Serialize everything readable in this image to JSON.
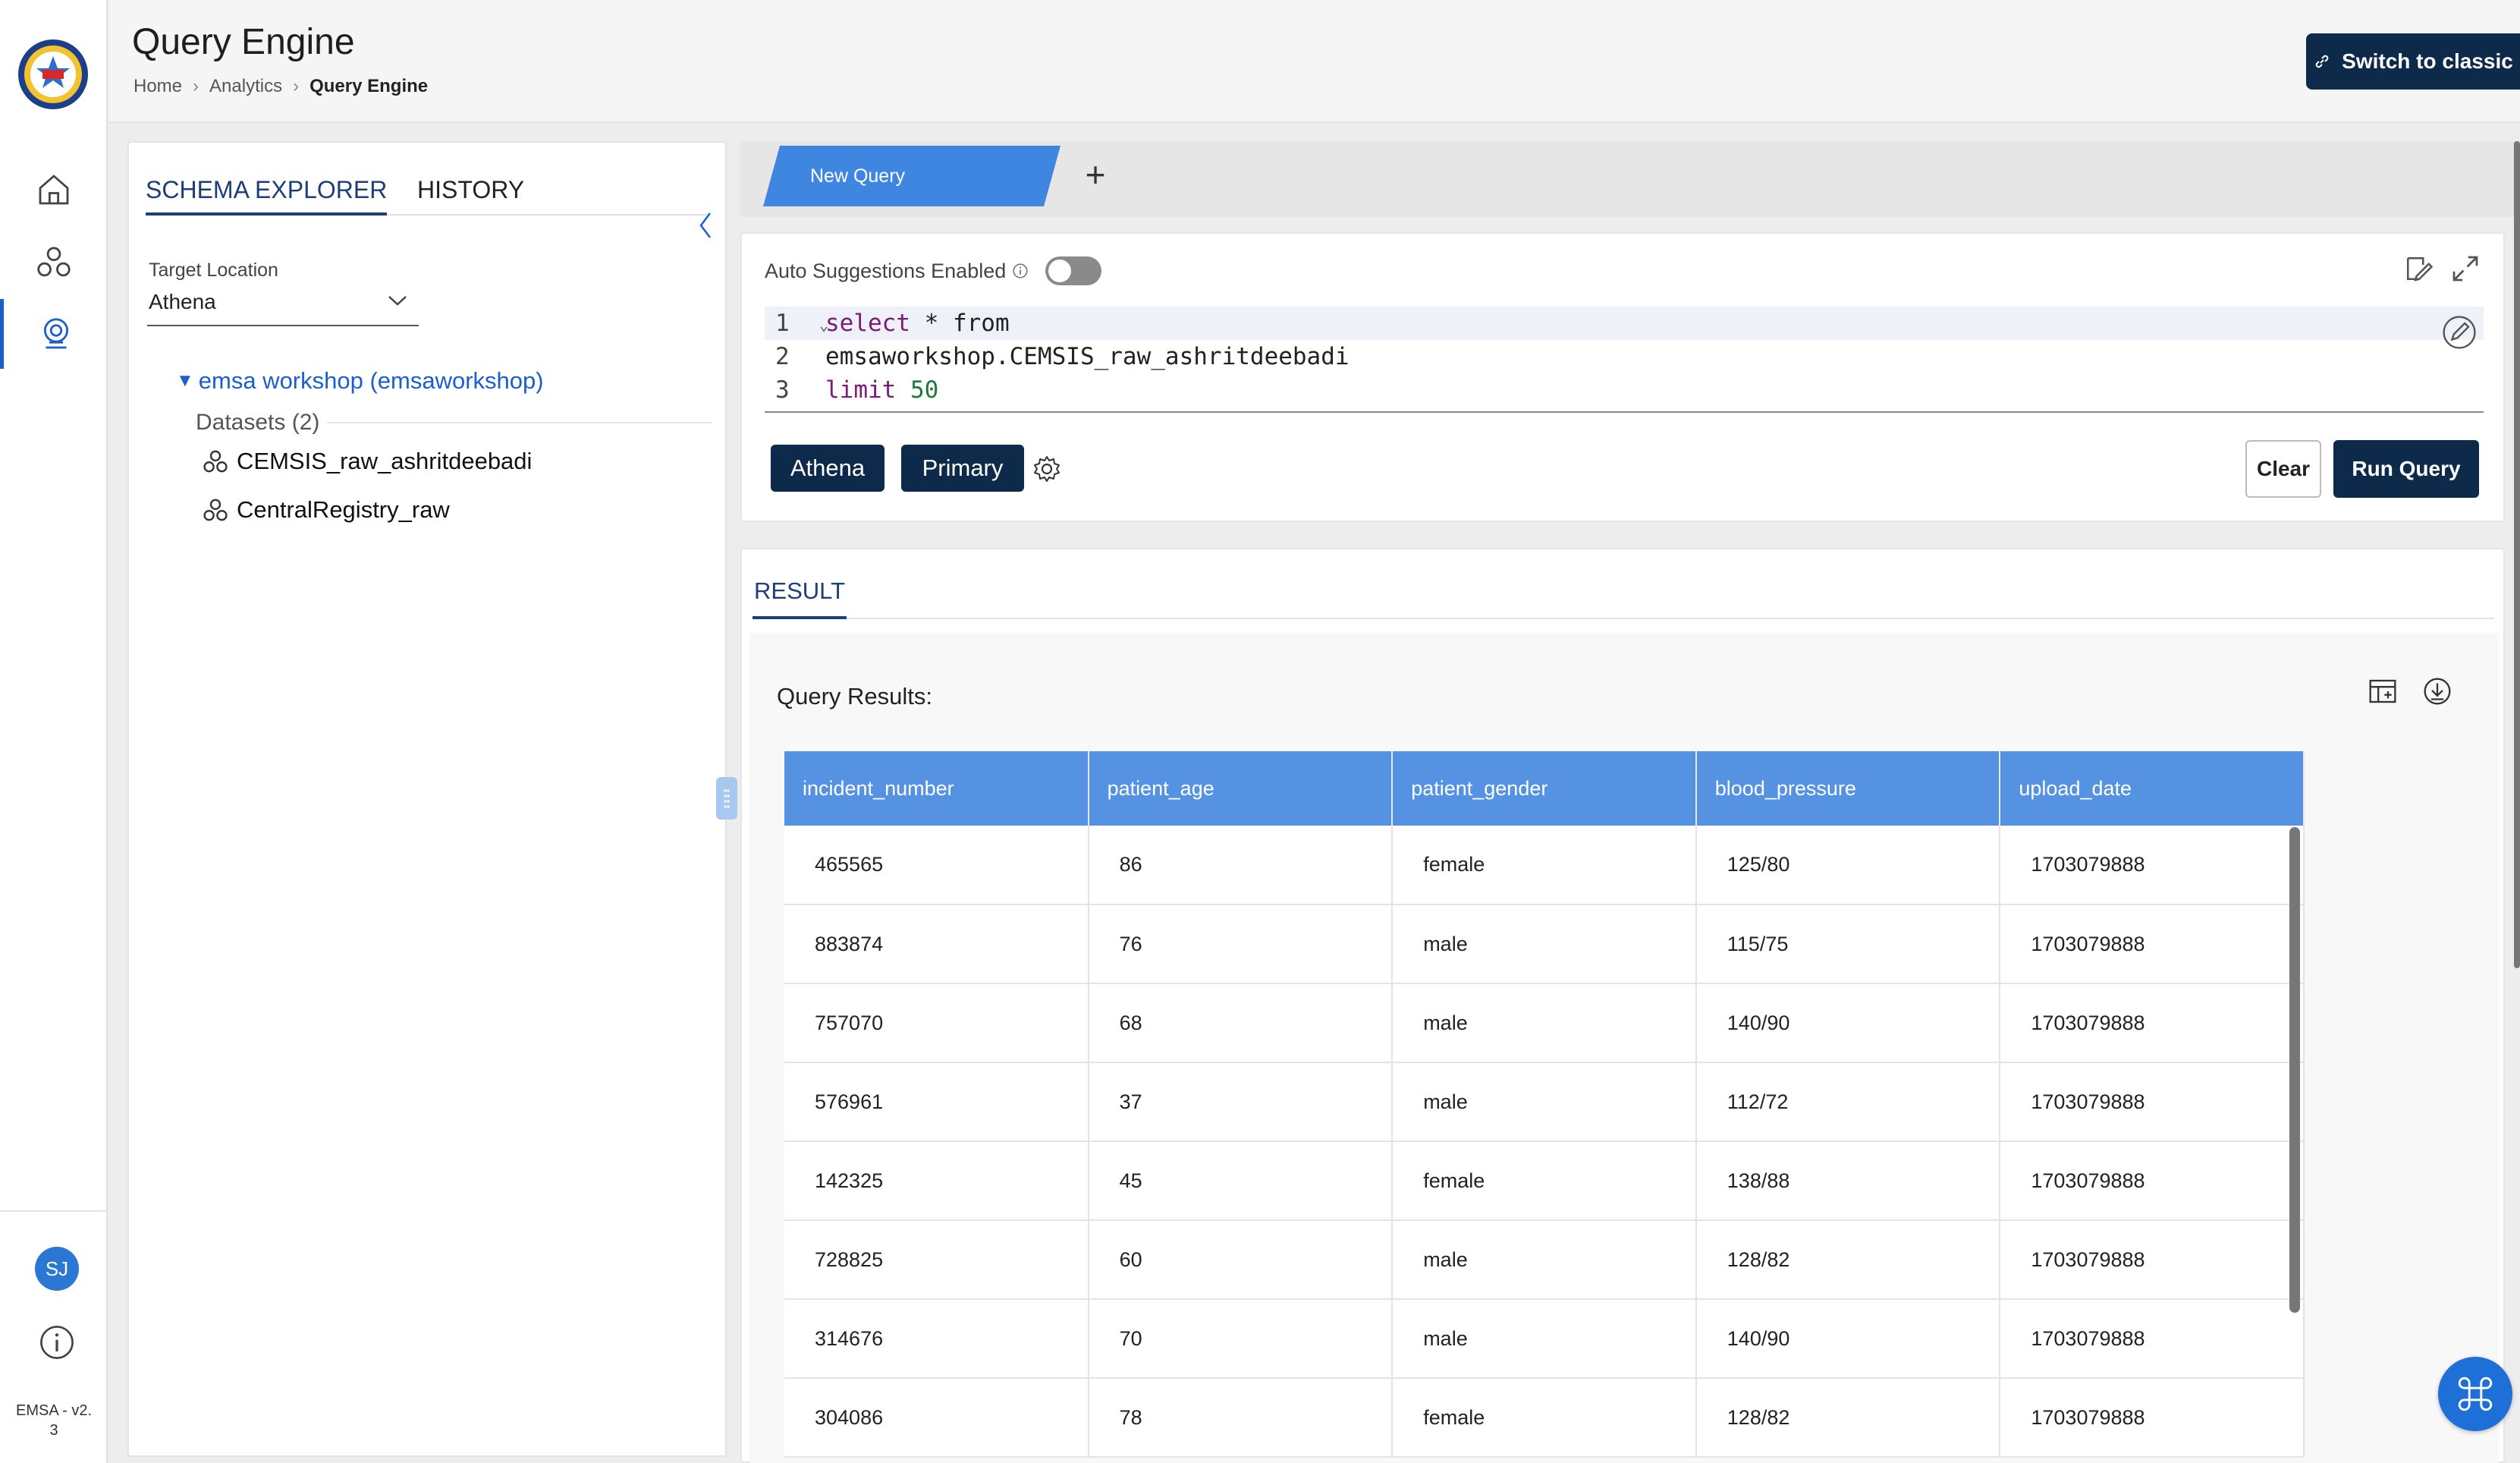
{
  "app": {
    "version": "EMSA - v2.\n3"
  },
  "nav": {
    "logo": "emsa-logo",
    "items": [
      {
        "name": "home-icon"
      },
      {
        "name": "datasets-icon"
      },
      {
        "name": "query-icon"
      }
    ],
    "avatar_initials": "SJ",
    "info_icon": "info-icon"
  },
  "header": {
    "title": "Query Engine",
    "breadcrumb": [
      "Home",
      "Analytics",
      "Query Engine"
    ],
    "switch_label": "Switch to classic"
  },
  "schema_explorer": {
    "tabs": [
      "SCHEMA EXPLORER",
      "HISTORY"
    ],
    "active_tab": "SCHEMA EXPLORER",
    "target_label": "Target Location",
    "target_value": "Athena",
    "database": "emsa workshop (emsaworkshop)",
    "datasets_label": "Datasets (2)",
    "datasets": [
      "CEMSIS_raw_ashritdeebadi",
      "CentralRegistry_raw"
    ]
  },
  "editor": {
    "tab_label": "New Query",
    "auto_suggestions_label": "Auto Suggestions Enabled",
    "auto_suggestions_on": false,
    "lines": [
      {
        "num": "1",
        "kw": "select",
        "rest": " * from"
      },
      {
        "num": "2",
        "kw": "",
        "rest": "emsaworkshop.CEMSIS_raw_ashritdeebadi"
      },
      {
        "num": "3",
        "kw": "limit",
        "lit": " 50"
      }
    ],
    "engine_label": "Athena",
    "workgroup_label": "Primary",
    "clear_label": "Clear",
    "run_label": "Run Query"
  },
  "result": {
    "tab_label": "RESULT",
    "title": "Query Results:",
    "columns": [
      "incident_number",
      "patient_age",
      "patient_gender",
      "blood_pressure",
      "upload_date"
    ],
    "rows": [
      [
        "465565",
        "86",
        "female",
        "125/80",
        "1703079888"
      ],
      [
        "883874",
        "76",
        "male",
        "115/75",
        "1703079888"
      ],
      [
        "757070",
        "68",
        "male",
        "140/90",
        "1703079888"
      ],
      [
        "576961",
        "37",
        "male",
        "112/72",
        "1703079888"
      ],
      [
        "142325",
        "45",
        "female",
        "138/88",
        "1703079888"
      ],
      [
        "728825",
        "60",
        "male",
        "128/82",
        "1703079888"
      ],
      [
        "314676",
        "70",
        "male",
        "140/90",
        "1703079888"
      ],
      [
        "304086",
        "78",
        "female",
        "128/82",
        "1703079888"
      ]
    ]
  },
  "colors": {
    "primary": "#0d2a4a",
    "accent": "#3f86e0",
    "table_header": "#5593e2"
  }
}
